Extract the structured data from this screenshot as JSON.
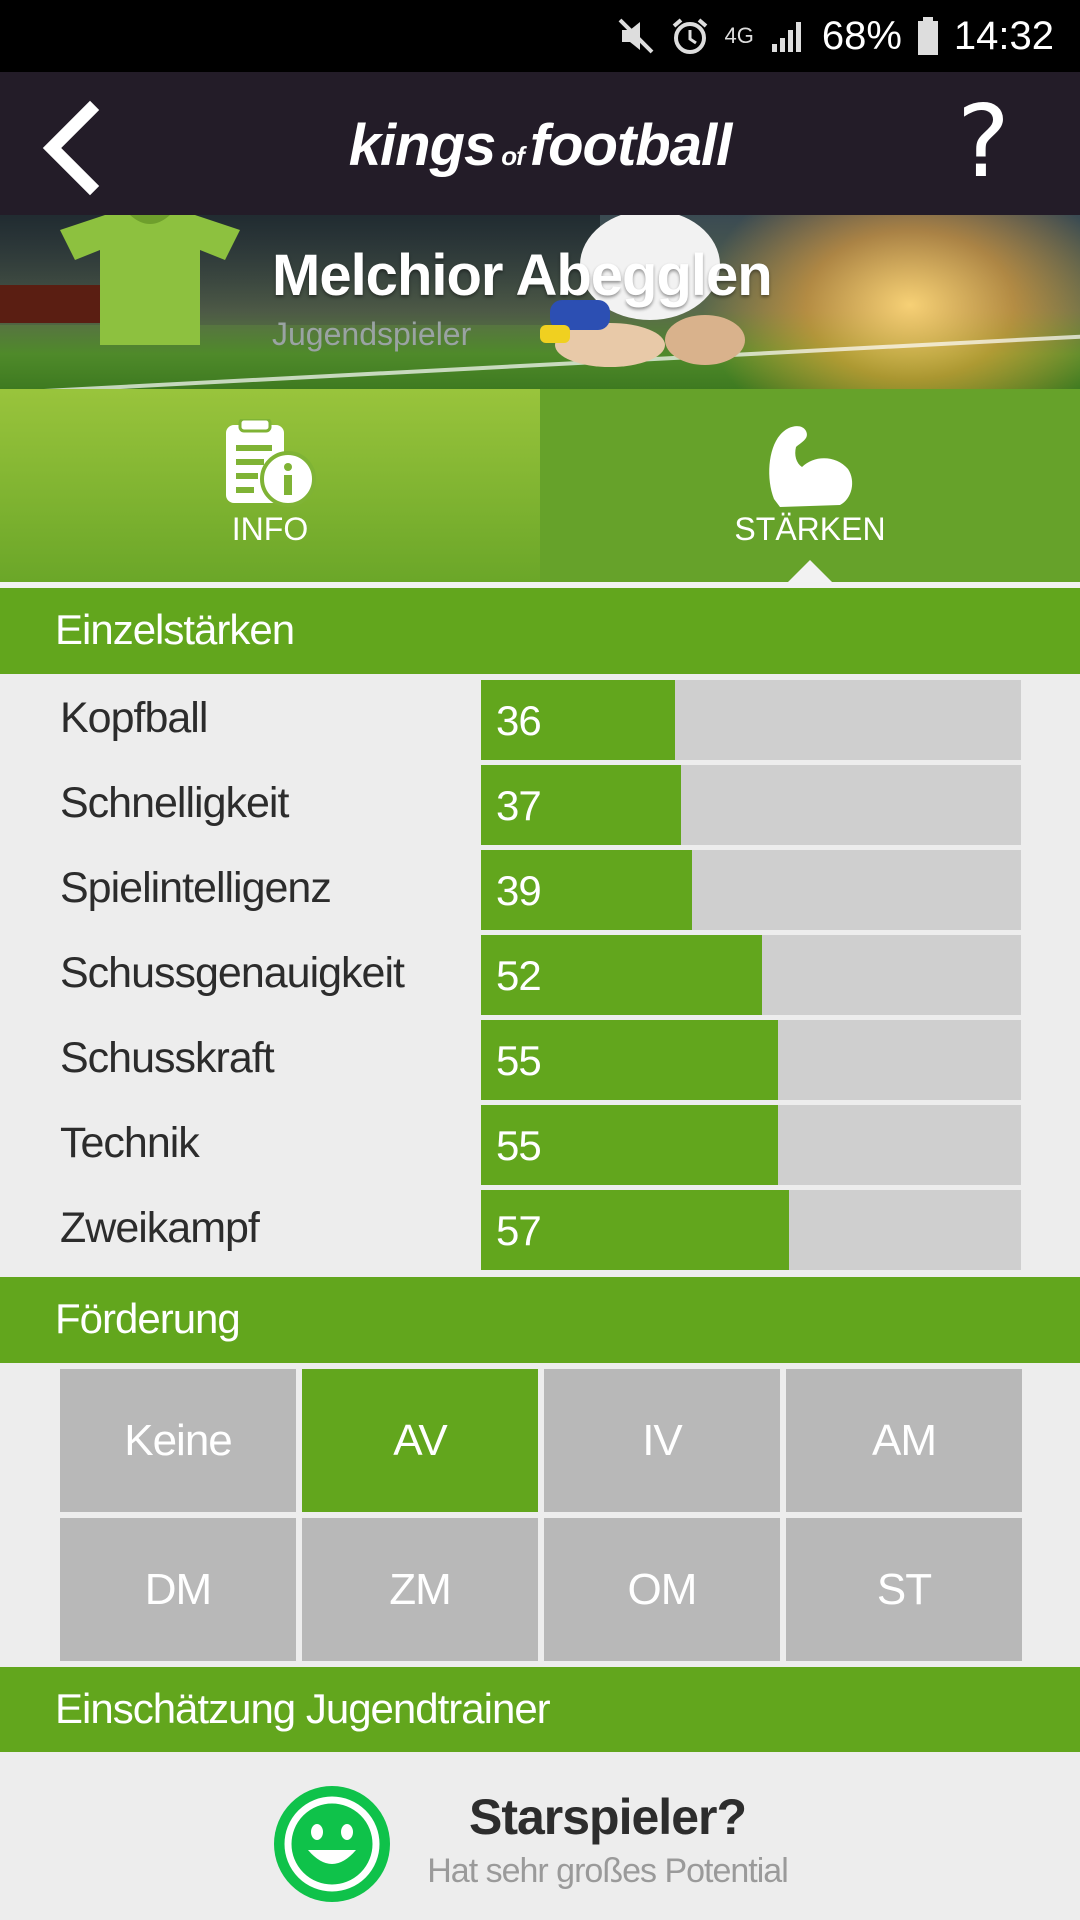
{
  "status_bar": {
    "icons": [
      "mute-icon",
      "alarm-icon",
      "network-4g-icon",
      "signal-icon"
    ],
    "network": "4G",
    "battery": "68%",
    "time": "14:32"
  },
  "header": {
    "logo_part1": "kings",
    "logo_part2": "of",
    "logo_part3": "football",
    "help": "?"
  },
  "player": {
    "name": "Melchior Abegglen",
    "role": "Jugendspieler",
    "jersey_color": "#8dc13f"
  },
  "tabs": [
    {
      "label": "INFO",
      "icon": "info-document-icon",
      "active": false
    },
    {
      "label": "STÄRKEN",
      "icon": "flexed-bicep-icon",
      "active": true
    }
  ],
  "sections": {
    "strengths_title": "Einzelstärken",
    "promotion_title": "Förderung",
    "assessment_title": "Einschätzung Jugendtrainer"
  },
  "strengths": [
    {
      "label": "Kopfball",
      "value": 36
    },
    {
      "label": "Schnelligkeit",
      "value": 37
    },
    {
      "label": "Spielintelligenz",
      "value": 39
    },
    {
      "label": "Schussgenauigkeit",
      "value": 52
    },
    {
      "label": "Schusskraft",
      "value": 55
    },
    {
      "label": "Technik",
      "value": 55
    },
    {
      "label": "Zweikampf",
      "value": 57
    }
  ],
  "strength_max": 100,
  "promotion_options": [
    "Keine",
    "AV",
    "IV",
    "AM",
    "DM",
    "ZM",
    "OM",
    "ST"
  ],
  "promotion_selected": "AV",
  "assessment": {
    "title": "Starspieler?",
    "subtitle": "Hat sehr großes Potential",
    "icon": "smiley-icon"
  },
  "colors": {
    "accent_green": "#62a61d",
    "header_dark": "#231c28",
    "bar_track": "#cfcfcf",
    "cell_gray": "#b8b8b8",
    "smiley_green": "#0fc24a"
  }
}
